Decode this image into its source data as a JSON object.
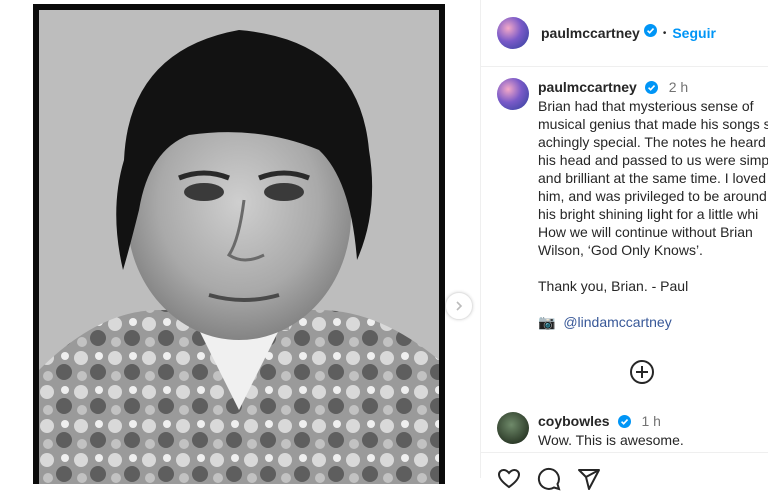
{
  "post": {
    "author": "paulmccartney",
    "follow_label": "Seguir",
    "separator": "•"
  },
  "caption": {
    "author": "paulmccartney",
    "time": "2 h",
    "lines": [
      "Brian had that mysterious sense of",
      "musical genius that made his songs s",
      "achingly special. The notes he heard",
      "his head and passed to us were simp",
      "and brilliant at the same time. I loved",
      "him, and was privileged to be around",
      "his bright shining light for a little whi",
      "How we will continue without Brian",
      "Wilson, ‘God Only Knows’."
    ],
    "signoff": "Thank you, Brian. - Paul",
    "camera_emoji": "📷",
    "photo_credit": "@lindamccartney"
  },
  "comments": [
    {
      "author": "coybowles",
      "time": "1 h",
      "text": "Wow. This is awesome."
    }
  ],
  "colors": {
    "verified": "#0095f6",
    "link": "#0095f6",
    "mention": "#385898",
    "border": "#efefef"
  },
  "icons": {
    "verified": "verified-badge-icon",
    "load_more": "plus-circle-icon",
    "next": "chevron-right-icon",
    "like": "heart-icon",
    "comment": "comment-icon",
    "share": "share-icon"
  }
}
